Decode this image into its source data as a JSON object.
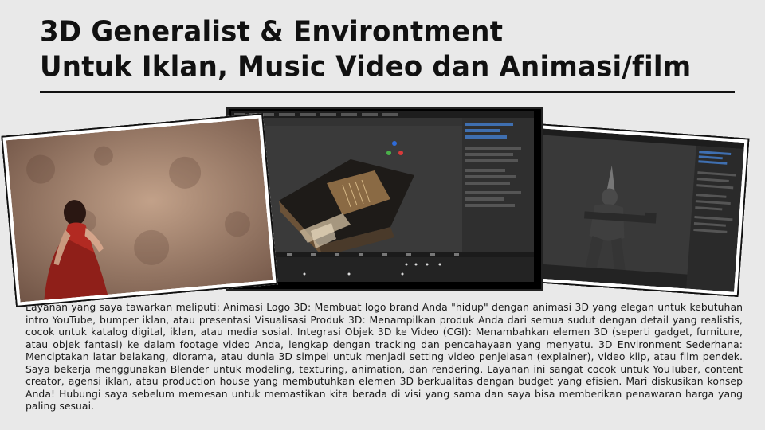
{
  "title": {
    "line1": "3D Generalist & Environtment",
    "line2": "Untuk Iklan, Music Video dan Animasi/film"
  },
  "images": [
    {
      "name": "left",
      "subject": "woman-in-red-dress-render"
    },
    {
      "name": "center",
      "subject": "blender-environment-scene-screenshot"
    },
    {
      "name": "right",
      "subject": "blender-soldier-character-screenshot"
    }
  ],
  "description": "Layanan yang saya tawarkan meliputi: Animasi Logo 3D: Membuat logo brand Anda \"hidup\" dengan animasi 3D yang elegan untuk kebutuhan intro YouTube, bumper iklan, atau presentasi Visualisasi Produk 3D: Menampilkan produk Anda dari semua sudut dengan detail yang realistis, cocok untuk katalog digital, iklan, atau media sosial. Integrasi Objek 3D ke Video (CGI): Menambahkan elemen 3D (seperti gadget, furniture, atau objek fantasi) ke dalam footage video Anda, lengkap dengan tracking dan pencahayaan yang menyatu. 3D Environment Sederhana: Menciptakan latar belakang, diorama, atau dunia 3D simpel untuk menjadi setting video penjelasan (explainer), video klip, atau film pendek. Saya bekerja menggunakan Blender untuk modeling, texturing, animation, dan rendering. Layanan ini sangat cocok untuk YouTuber, content creator, agensi iklan, atau production house yang membutuhkan elemen 3D berkualitas dengan budget yang efisien. Mari diskusikan konsep Anda! Hubungi saya sebelum memesan untuk memastikan kita berada di visi yang sama dan saya bisa memberikan penawaran harga yang paling sesuai."
}
